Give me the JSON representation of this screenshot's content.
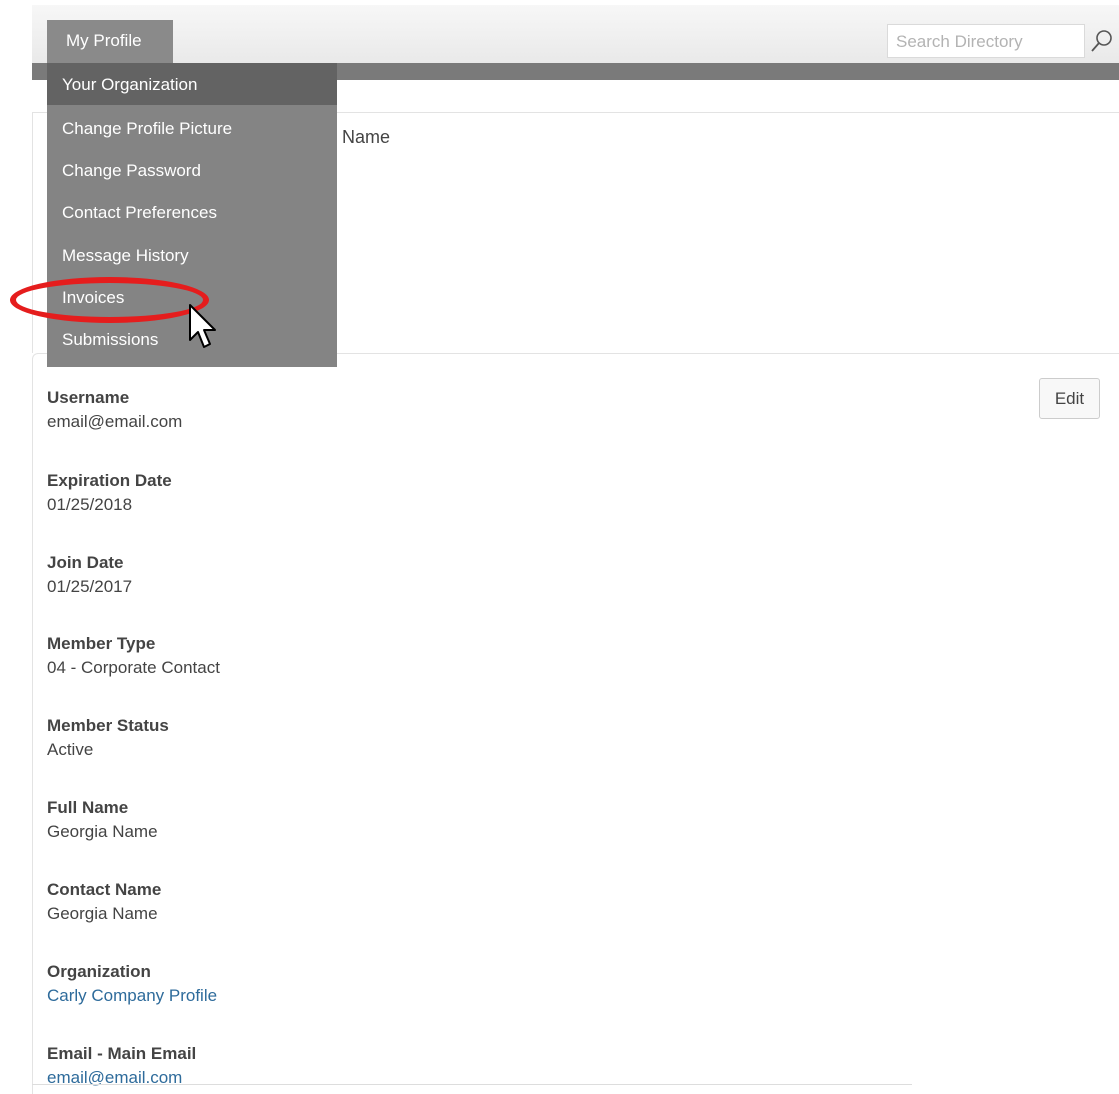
{
  "nav": {
    "my_profile_tab": "My Profile",
    "search_placeholder": "Search Directory"
  },
  "dropdown": {
    "items": [
      {
        "label": "Your Organization"
      },
      {
        "label": "Change Profile Picture"
      },
      {
        "label": "Change Password"
      },
      {
        "label": "Contact Preferences"
      },
      {
        "label": "Message History"
      },
      {
        "label": "Invoices"
      },
      {
        "label": "Submissions"
      }
    ]
  },
  "header": {
    "name_label": "Name"
  },
  "profile": {
    "edit_label": "Edit",
    "fields": [
      {
        "label": "Username",
        "value": "email@email.com"
      },
      {
        "label": "Expiration Date",
        "value": "01/25/2018"
      },
      {
        "label": "Join Date",
        "value": "01/25/2017"
      },
      {
        "label": "Member Type",
        "value": "04 - Corporate Contact"
      },
      {
        "label": "Member Status",
        "value": "Active"
      },
      {
        "label": "Full Name",
        "value": "Georgia Name"
      },
      {
        "label": "Contact Name",
        "value": "Georgia Name"
      },
      {
        "label": "Organization",
        "value": "Carly Company Profile"
      },
      {
        "label": "Email - Main Email",
        "value": "email@email.com"
      }
    ]
  },
  "colors": {
    "highlight": "#e51d1d",
    "link": "#2e6b9b",
    "menu_bg": "#848484"
  },
  "icons": {
    "search": "search-icon",
    "cursor": "mouse-pointer-icon"
  }
}
